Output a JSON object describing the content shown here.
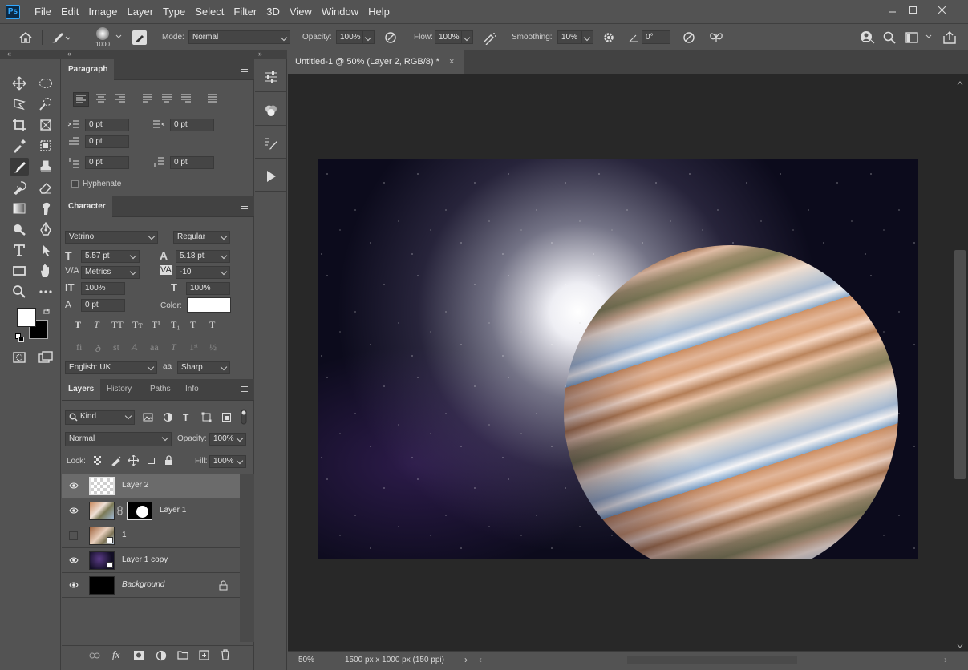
{
  "app": {
    "logo": "Ps",
    "menus": [
      "File",
      "Edit",
      "Image",
      "Layer",
      "Type",
      "Select",
      "Filter",
      "3D",
      "View",
      "Window",
      "Help"
    ]
  },
  "options_bar": {
    "brush_size": "1000",
    "mode_label": "Mode:",
    "mode_value": "Normal",
    "opacity_label": "Opacity:",
    "opacity_value": "100%",
    "flow_label": "Flow:",
    "flow_value": "100%",
    "smoothing_label": "Smoothing:",
    "smoothing_value": "10%",
    "angle_value": "0°"
  },
  "paragraph_panel": {
    "title": "Paragraph",
    "indent_left": "0 pt",
    "indent_right": "0 pt",
    "indent_first": "0 pt",
    "space_before": "0 pt",
    "space_after": "0 pt",
    "hyphenate_label": "Hyphenate"
  },
  "character_panel": {
    "title": "Character",
    "font_family": "Vetrino",
    "font_style": "Regular",
    "font_size": "5.57 pt",
    "leading": "5.18 pt",
    "kerning": "Metrics",
    "tracking": "-10",
    "vertical_scale": "100%",
    "horizontal_scale": "100%",
    "baseline_shift": "0 pt",
    "color_label": "Color:",
    "language": "English: UK",
    "antialias_icon": "aa",
    "antialias": "Sharp"
  },
  "layers_panel": {
    "tabs": [
      "Layers",
      "History",
      "Paths",
      "Info"
    ],
    "filter_kind": "Kind",
    "blend_mode": "Normal",
    "opacity_label": "Opacity:",
    "opacity_value": "100%",
    "lock_label": "Lock:",
    "fill_label": "Fill:",
    "fill_value": "100%",
    "layers": [
      {
        "name": "Layer 2",
        "visible": true
      },
      {
        "name": "Layer 1",
        "visible": true
      },
      {
        "name": "1",
        "visible": false
      },
      {
        "name": "Layer 1 copy",
        "visible": true
      },
      {
        "name": "Background",
        "visible": true
      }
    ]
  },
  "document": {
    "tab_title": "Untitled-1 @ 50% (Layer 2, RGB/8) *",
    "zoom": "50%",
    "doc_info": "1500 px x 1000 px (150 ppi)"
  },
  "colors": {
    "ui_bg": "#535353",
    "panel_header": "#424242",
    "canvas_bg": "#282828",
    "foreground": "#ffffff",
    "background": "#000000",
    "ps_blue": "#31a8ff"
  }
}
